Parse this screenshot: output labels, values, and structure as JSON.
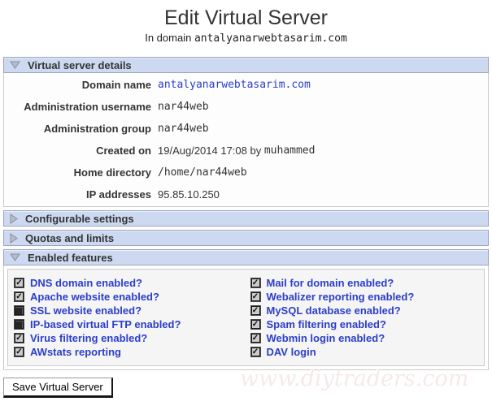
{
  "page": {
    "title": "Edit Virtual Server",
    "subtitle_prefix": "In domain",
    "domain": "antalyanarwebtasarim.com"
  },
  "sections": {
    "details": {
      "title": "Virtual server details",
      "expanded": true,
      "rows": [
        {
          "label": "Domain name",
          "value": "antalyanarwebtasarim.com",
          "mono": true,
          "link": true
        },
        {
          "label": "Administration username",
          "value": "nar44web",
          "mono": true
        },
        {
          "label": "Administration group",
          "value": "nar44web",
          "mono": true
        },
        {
          "label": "Created on",
          "value": "19/Aug/2014 17:08 by ",
          "value_mono": "muhammed"
        },
        {
          "label": "Home directory",
          "value": "/home/nar44web",
          "mono": true
        },
        {
          "label": "IP addresses",
          "value": "95.85.10.250"
        }
      ]
    },
    "configurable": {
      "title": "Configurable settings",
      "expanded": false
    },
    "quotas": {
      "title": "Quotas and limits",
      "expanded": false
    },
    "features": {
      "title": "Enabled features",
      "expanded": true,
      "left": [
        {
          "label": "DNS domain enabled?",
          "checked": true
        },
        {
          "label": "Apache website enabled?",
          "checked": true
        },
        {
          "label": "SSL website enabled?",
          "checked": false
        },
        {
          "label": "IP-based virtual FTP enabled?",
          "checked": false
        },
        {
          "label": "Virus filtering enabled?",
          "checked": true
        },
        {
          "label": "AWstats reporting",
          "checked": true
        }
      ],
      "right": [
        {
          "label": "Mail for domain enabled?",
          "checked": true
        },
        {
          "label": "Webalizer reporting enabled?",
          "checked": true
        },
        {
          "label": "MySQL database enabled?",
          "checked": true
        },
        {
          "label": "Spam filtering enabled?",
          "checked": true
        },
        {
          "label": "Webmin login enabled?",
          "checked": true
        },
        {
          "label": "DAV login",
          "checked": true
        }
      ]
    }
  },
  "save_button": "Save Virtual Server",
  "watermark": "www.diytraders.com",
  "colors": {
    "header_bg": "#cdd9f1",
    "header_border": "#9aa3ba",
    "link_blue": "#2b3ec9",
    "box_bg": "#f5f5f5"
  }
}
